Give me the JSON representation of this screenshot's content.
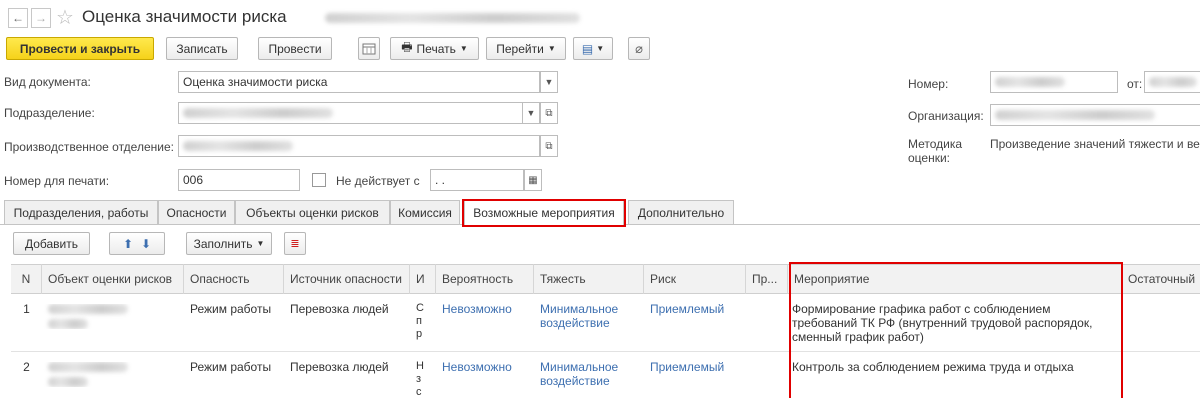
{
  "header": {
    "title": "Оценка значимости риска"
  },
  "toolbar": {
    "post_close": "Провести и закрыть",
    "save": "Записать",
    "post": "Провести",
    "print": "Печать",
    "goto": "Перейти"
  },
  "form": {
    "doc_type_label": "Вид документа:",
    "doc_type_value": "Оценка значимости риска",
    "division_label": "Подразделение:",
    "prod_dept_label": "Производственное отделение:",
    "print_number_label": "Номер для печати:",
    "print_number_value": "006",
    "inactive_from_label": "Не действует с",
    "inactive_from_value": " .  .",
    "number_label": "Номер:",
    "from_label": "от:",
    "org_label": "Организация:",
    "method_label": "Методика оценки:",
    "method_value": "Произведение значений тяжести и вер"
  },
  "tabs": [
    "Подразделения, работы",
    "Опасности",
    "Объекты оценки рисков",
    "Комиссия",
    "Возможные мероприятия",
    "Дополнительно"
  ],
  "table_toolbar": {
    "add": "Добавить",
    "fill": "Заполнить"
  },
  "table": {
    "columns": [
      "N",
      "Объект оценки рисков",
      "Опасность",
      "Источник опасности",
      "И",
      "Вероятность",
      "Тяжесть",
      "Риск",
      "Пр...",
      "Мероприятие",
      "Остаточный"
    ],
    "rows": [
      {
        "n": "1",
        "hazard": "Режим работы",
        "source": "Перевозка людей",
        "col_i": "С\nп\nр",
        "probability": "Невозможно",
        "severity": "Минимальное воздействие",
        "risk": "Приемлемый",
        "measure": "Формирование графика работ с соблюдением требований ТК РФ (внутренний трудовой распорядок, сменный график работ)"
      },
      {
        "n": "2",
        "hazard": "Режим работы",
        "source": "Перевозка людей",
        "col_i": "Н\nз\nс",
        "probability": "Невозможно",
        "severity": "Минимальное воздействие",
        "risk": "Приемлемый",
        "measure": "Контроль за соблюдением режима труда и отдыха"
      }
    ]
  }
}
